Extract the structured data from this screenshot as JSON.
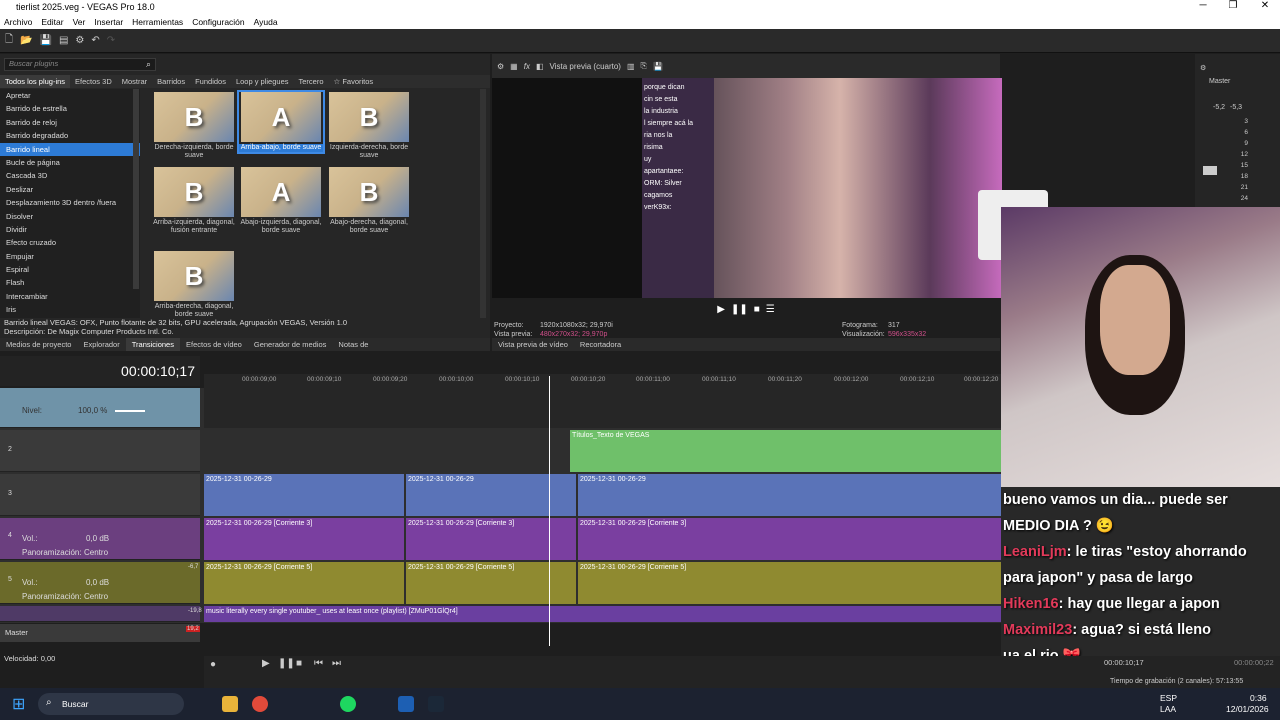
{
  "window": {
    "title": "tierlist 2025.veg - VEGAS Pro 18.0",
    "min": "─",
    "max": "❐",
    "close": "✕"
  },
  "menu": [
    "Archivo",
    "Editar",
    "Ver",
    "Insertar",
    "Herramientas",
    "Configuración",
    "Ayuda"
  ],
  "fx": {
    "search_placeholder": "Buscar plugins",
    "tabs": [
      "Todos los plug-ins",
      "Efectos 3D",
      "Mostrar",
      "Barridos",
      "Fundidos",
      "Loop y pliegues",
      "Tercero",
      "☆ Favoritos"
    ],
    "list": [
      "Apretar",
      "Barrido de estrella",
      "Barrido de reloj",
      "Barrido degradado",
      "Barrido lineal",
      "Bucle de página",
      "Cascada 3D",
      "Deslizar",
      "Desplazamiento 3D dentro /fuera",
      "Disolver",
      "Dividir",
      "Efecto cruzado",
      "Empujar",
      "Espiral",
      "Flash",
      "Intercambiar",
      "Iris"
    ],
    "presets": [
      {
        "label": "Derecha-izquierda, borde suave",
        "glyph": "B"
      },
      {
        "label": "Arriba-abajo, borde suave",
        "glyph": "A"
      },
      {
        "label": "Izquierda-derecha, borde suave",
        "glyph": "B"
      },
      {
        "label": "Arriba-izquierda, diagonal, fusión entrante",
        "glyph": "B"
      },
      {
        "label": "Abajo-izquierda, diagonal, borde suave",
        "glyph": "A"
      },
      {
        "label": "Abajo-derecha, diagonal, borde suave",
        "glyph": "B"
      },
      {
        "label": "Arriba-derecha, diagonal, borde suave",
        "glyph": "B"
      }
    ],
    "desc1": "Barrido lineal VEGAS: OFX, Punto flotante de 32 bits, GPU acelerada, Agrupación VEGAS, Versión 1.0",
    "desc2": "Descripción: De Magix Computer Products Intl. Co."
  },
  "wintabs": [
    "Medios de proyecto",
    "Explorador",
    "Transiciones",
    "Efectos de vídeo",
    "Generador de medios",
    "Notas de"
  ],
  "preview": {
    "mode": "Vista previa (cuarto)",
    "project_label": "Proyecto:",
    "project": "1920x1080x32; 29,970i",
    "prev_label": "Vista previa:",
    "prev": "480x270x32; 29,970p",
    "frame_label": "Fotograma:",
    "frame": "317",
    "vis_label": "Visualización:",
    "vis": "596x335x32",
    "tabs": [
      "Vista previa de vídeo",
      "Recortadora"
    ],
    "chat": [
      "porque dican",
      "cin se esta",
      "la industria",
      "l siempre acá la",
      "ria nos la",
      "risima",
      "uy",
      "apartantaee:",
      "ORM: Silver",
      "cagamos",
      "verK93x:"
    ]
  },
  "master": {
    "label": "Master",
    "vals": [
      "-5,2",
      "-5,3"
    ],
    "scale": [
      "3",
      "6",
      "9",
      "12",
      "15",
      "18",
      "21",
      "24"
    ]
  },
  "timeline": {
    "timecode": "00:00:10;17",
    "ticks": [
      "00:00:09;00",
      "00:00:09;10",
      "00:00:09;20",
      "00:00:10;00",
      "00:00:10;10",
      "00:00:10;20",
      "00:00:11;00",
      "00:00:11;10",
      "00:00:11;20",
      "00:00:12;00",
      "00:00:12;10",
      "00:00:12;20"
    ],
    "level_label": "Nivel:",
    "level": "100,0 %",
    "title_clip": "Títulos_Texto de VEGAS",
    "video_clip": "2025-12-31 00-26-29",
    "audio3": "2025-12-31 00-26-29 [Corriente 3]",
    "audio5": "2025-12-31 00-26-29 [Corriente 5]",
    "music": "music literally every single youtuber_ uses at least once (playlist) [ZMuP01GlQr4]",
    "vol_label": "Vol.:",
    "vol": "0,0 dB",
    "pan_label": "Panoramización:",
    "pan": "Centro",
    "master_label": "Master",
    "speed": "Velocidad: 0,00",
    "db_scale": [
      "12",
      "24",
      "36",
      "48"
    ],
    "peak1": "-6,7",
    "peak2": "-19,8",
    "peak3": "19,2",
    "track_nums": [
      "1",
      "2",
      "3",
      "4",
      "5"
    ]
  },
  "bottom": {
    "cursor_time": "00:00:10;17",
    "end_time": "00:00:00;22",
    "rec_time": "Tiempo de grabación (2 canales): 57:13:55"
  },
  "stream_chat": [
    {
      "user": "",
      "text": "bueno vamos un dia... puede ser"
    },
    {
      "user": "",
      "text": "MEDIO DIA ? 😉"
    },
    {
      "user": "LeaniLjm",
      "text": ": le tiras \"estoy ahorrando"
    },
    {
      "user": "",
      "text": "para japon\" y pasa de largo"
    },
    {
      "user": "Hiken16",
      "text": ": hay que llegar a japon"
    },
    {
      "user": "Maximil23",
      "text": ": agua? si está lleno"
    },
    {
      "user": "",
      "text": "ua el rio 🎀"
    }
  ],
  "overlay_badge": "x2",
  "taskbar": {
    "search": "Buscar",
    "lang1": "ESP",
    "lang2": "LAA",
    "time": "0:36",
    "date": "12/01/2026"
  },
  "colors": {
    "accent": "#2d7bd6",
    "video_track": "#5a73b8",
    "title_track": "#6fc06a",
    "audio_purple": "#7a3fa0",
    "audio_olive": "#8f8a30"
  }
}
